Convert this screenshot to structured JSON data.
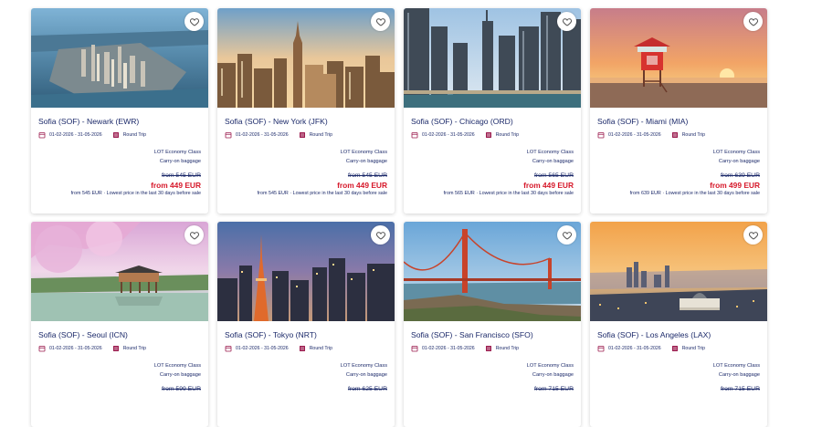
{
  "cards": [
    {
      "route": "Sofia (SOF) - Newark (EWR)",
      "dates": "01-02-2026 - 31-05-2026",
      "trip": "Round Trip",
      "cabin": "LOT Economy Class",
      "baggage": "Carry-on baggage",
      "old_price": "from 545 EUR",
      "new_price": "from 449 EUR",
      "lowest": "from 545 EUR · Lowest price in the last 30 days before sale"
    },
    {
      "route": "Sofia (SOF) - New York (JFK)",
      "dates": "01-02-2026 - 31-05-2026",
      "trip": "Round Trip",
      "cabin": "LOT Economy Class",
      "baggage": "Carry-on baggage",
      "old_price": "from 545 EUR",
      "new_price": "from 449 EUR",
      "lowest": "from 545 EUR · Lowest price in the last 30 days before sale"
    },
    {
      "route": "Sofia (SOF) - Chicago (ORD)",
      "dates": "01-02-2026 - 31-05-2026",
      "trip": "Round Trip",
      "cabin": "LOT Economy Class",
      "baggage": "Carry-on baggage",
      "old_price": "from 565 EUR",
      "new_price": "from 449 EUR",
      "lowest": "from 565 EUR · Lowest price in the last 30 days before sale"
    },
    {
      "route": "Sofia (SOF) - Miami (MIA)",
      "dates": "01-02-2026 - 31-05-2026",
      "trip": "Round Trip",
      "cabin": "LOT Economy Class",
      "baggage": "Carry-on baggage",
      "old_price": "from 639 EUR",
      "new_price": "from 499 EUR",
      "lowest": "from 639 EUR · Lowest price in the last 30 days before sale"
    },
    {
      "route": "Sofia (SOF) - Seoul (ICN)",
      "dates": "01-02-2026 - 31-05-2026",
      "trip": "Round Trip",
      "cabin": "LOT Economy Class",
      "baggage": "Carry-on baggage",
      "old_price": "from 599 EUR",
      "new_price": "",
      "lowest": ""
    },
    {
      "route": "Sofia (SOF) - Tokyo (NRT)",
      "dates": "01-02-2026 - 31-05-2026",
      "trip": "Round Trip",
      "cabin": "LOT Economy Class",
      "baggage": "Carry-on baggage",
      "old_price": "from 625 EUR",
      "new_price": "",
      "lowest": ""
    },
    {
      "route": "Sofia (SOF) - San Francisco (SFO)",
      "dates": "01-02-2026 - 31-05-2026",
      "trip": "Round Trip",
      "cabin": "LOT Economy Class",
      "baggage": "Carry-on baggage",
      "old_price": "from 715 EUR",
      "new_price": "",
      "lowest": ""
    },
    {
      "route": "Sofia (SOF) - Los Angeles (LAX)",
      "dates": "01-02-2026 - 31-05-2026",
      "trip": "Round Trip",
      "cabin": "LOT Economy Class",
      "baggage": "Carry-on baggage",
      "old_price": "from 715 EUR",
      "new_price": "",
      "lowest": ""
    }
  ],
  "icons": {
    "favorite": "heart-icon",
    "dates": "calendar-icon",
    "trip": "round-trip-icon"
  },
  "colors": {
    "brand": "#1c2a6a",
    "sale": "#d6182a",
    "icon": "#9b1b4e"
  }
}
